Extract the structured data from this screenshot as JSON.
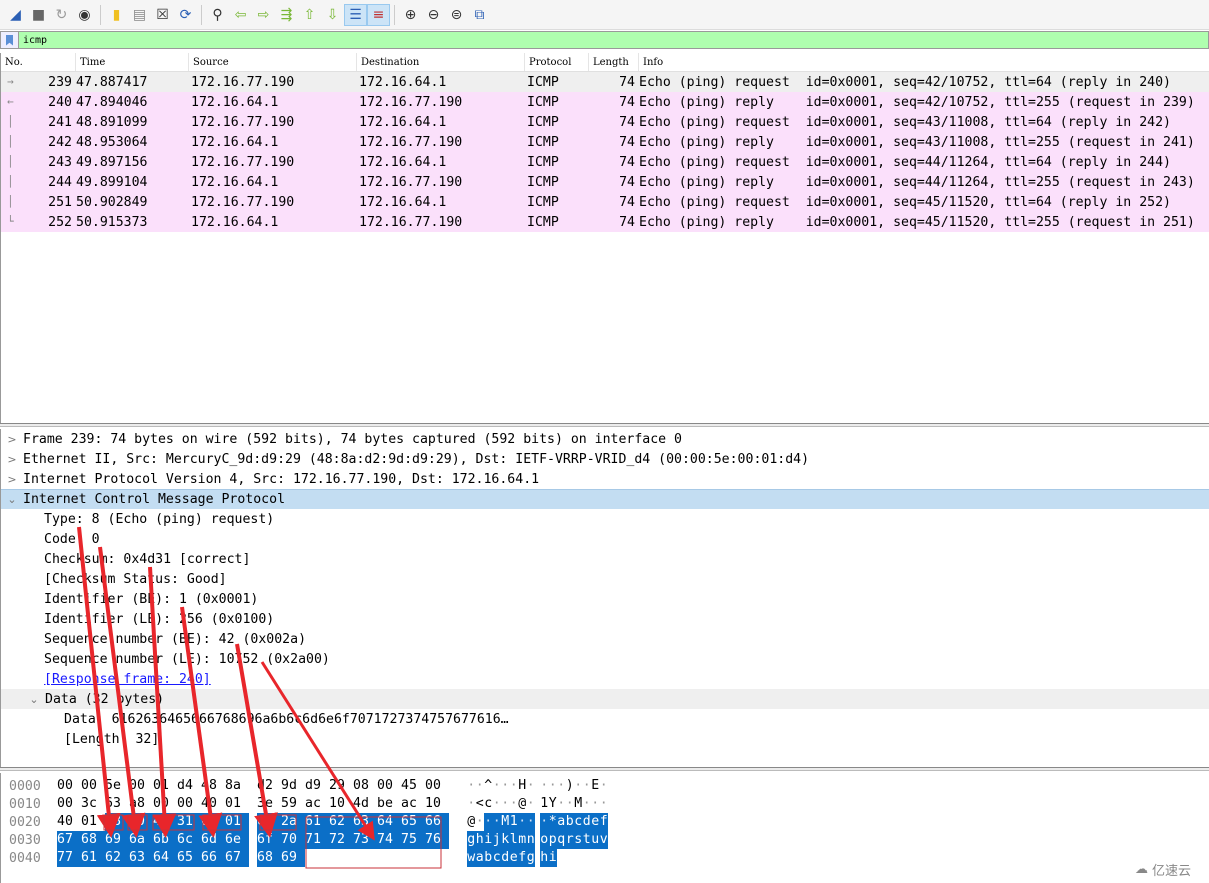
{
  "toolbar": {
    "buttons": [
      {
        "name": "start-capture-icon",
        "glyph": "◢"
      },
      {
        "name": "stop-capture-icon",
        "glyph": "■"
      },
      {
        "name": "restart-capture-icon",
        "glyph": "↻"
      },
      {
        "name": "capture-options-icon",
        "glyph": "◉"
      },
      {
        "name": "open-file-icon",
        "glyph": "▮"
      },
      {
        "name": "save-file-icon",
        "glyph": "▤"
      },
      {
        "name": "close-file-icon",
        "glyph": "☒"
      },
      {
        "name": "reload-file-icon",
        "glyph": "⟳"
      },
      {
        "name": "find-packet-icon",
        "glyph": "⚲"
      },
      {
        "name": "go-back-icon",
        "glyph": "⇦"
      },
      {
        "name": "go-forward-icon",
        "glyph": "⇨"
      },
      {
        "name": "go-to-packet-icon",
        "glyph": "⇶"
      },
      {
        "name": "go-first-packet-icon",
        "glyph": "⇧"
      },
      {
        "name": "go-last-packet-icon",
        "glyph": "⇩"
      },
      {
        "name": "auto-scroll-icon",
        "glyph": "☰"
      },
      {
        "name": "colorize-icon",
        "glyph": "≡"
      },
      {
        "name": "zoom-in-icon",
        "glyph": "⊕"
      },
      {
        "name": "zoom-out-icon",
        "glyph": "⊖"
      },
      {
        "name": "normal-size-icon",
        "glyph": "⊜"
      },
      {
        "name": "resize-columns-icon",
        "glyph": "⧉"
      }
    ]
  },
  "filter": {
    "value": "icmp"
  },
  "packet_list": {
    "columns": [
      "No.",
      "Time",
      "Source",
      "Destination",
      "Protocol",
      "Length",
      "Info"
    ],
    "rows": [
      {
        "no": "239",
        "time": "47.887417",
        "src": "172.16.77.190",
        "dst": "172.16.64.1",
        "proto": "ICMP",
        "len": "74",
        "info": "Echo (ping) request  id=0x0001, seq=42/10752, ttl=64 (reply in 240)",
        "rel": "→"
      },
      {
        "no": "240",
        "time": "47.894046",
        "src": "172.16.64.1",
        "dst": "172.16.77.190",
        "proto": "ICMP",
        "len": "74",
        "info": "Echo (ping) reply    id=0x0001, seq=42/10752, ttl=255 (request in 239)",
        "rel": "←"
      },
      {
        "no": "241",
        "time": "48.891099",
        "src": "172.16.77.190",
        "dst": "172.16.64.1",
        "proto": "ICMP",
        "len": "74",
        "info": "Echo (ping) request  id=0x0001, seq=43/11008, ttl=64 (reply in 242)",
        "rel": "│"
      },
      {
        "no": "242",
        "time": "48.953064",
        "src": "172.16.64.1",
        "dst": "172.16.77.190",
        "proto": "ICMP",
        "len": "74",
        "info": "Echo (ping) reply    id=0x0001, seq=43/11008, ttl=255 (request in 241)",
        "rel": "│"
      },
      {
        "no": "243",
        "time": "49.897156",
        "src": "172.16.77.190",
        "dst": "172.16.64.1",
        "proto": "ICMP",
        "len": "74",
        "info": "Echo (ping) request  id=0x0001, seq=44/11264, ttl=64 (reply in 244)",
        "rel": "│"
      },
      {
        "no": "244",
        "time": "49.899104",
        "src": "172.16.64.1",
        "dst": "172.16.77.190",
        "proto": "ICMP",
        "len": "74",
        "info": "Echo (ping) reply    id=0x0001, seq=44/11264, ttl=255 (request in 243)",
        "rel": "│"
      },
      {
        "no": "251",
        "time": "50.902849",
        "src": "172.16.77.190",
        "dst": "172.16.64.1",
        "proto": "ICMP",
        "len": "74",
        "info": "Echo (ping) request  id=0x0001, seq=45/11520, ttl=64 (reply in 252)",
        "rel": "│"
      },
      {
        "no": "252",
        "time": "50.915373",
        "src": "172.16.64.1",
        "dst": "172.16.77.190",
        "proto": "ICMP",
        "len": "74",
        "info": "Echo (ping) reply    id=0x0001, seq=45/11520, ttl=255 (request in 251)",
        "rel": "└"
      }
    ]
  },
  "details": {
    "frame": "Frame 239: 74 bytes on wire (592 bits), 74 bytes captured (592 bits) on interface 0",
    "ethernet": "Ethernet II, Src: MercuryC_9d:d9:29 (48:8a:d2:9d:d9:29), Dst: IETF-VRRP-VRID_d4 (00:00:5e:00:01:d4)",
    "ip": "Internet Protocol Version 4, Src: 172.16.77.190, Dst: 172.16.64.1",
    "icmp": "Internet Control Message Protocol",
    "fields": [
      "Type: 8 (Echo (ping) request)",
      "Code: 0",
      "Checksum: 0x4d31 [correct]",
      "[Checksum Status: Good]",
      "Identifier (BE): 1 (0x0001)",
      "Identifier (LE): 256 (0x0100)",
      "Sequence number (BE): 42 (0x002a)",
      "Sequence number (LE): 10752 (0x2a00)"
    ],
    "response_link": "[Response frame: 240]",
    "data_node": "Data (32 bytes)",
    "data_value": "Data: 6162636465666768696a6b6c6d6e6f7071727374757677616…",
    "data_length": "[Length: 32]",
    "collapsed_glyph": ">",
    "expanded_glyph": "⌄"
  },
  "bytes": {
    "rows": [
      {
        "offset": "0000",
        "hex": [
          "00",
          "00",
          "5e",
          "00",
          "01",
          "d4",
          "48",
          "8a",
          "d2",
          "9d",
          "d9",
          "29",
          "08",
          "00",
          "45",
          "00"
        ],
        "ascii": "··^···H·)··E·",
        "sel_from": 99
      },
      {
        "offset": "0010",
        "hex": [
          "00",
          "3c",
          "63",
          "a8",
          "00",
          "00",
          "40",
          "01",
          "3e",
          "59",
          "ac",
          "10",
          "4d",
          "be",
          "ac",
          "10"
        ],
        "ascii": "·<c···@·>Y··M···",
        "sel_from": 99
      },
      {
        "offset": "0020",
        "hex": [
          "40",
          "01",
          "08",
          "00",
          "4d",
          "31",
          "00",
          "01",
          "00",
          "2a",
          "61",
          "62",
          "63",
          "64",
          "65",
          "66"
        ],
        "ascii": "@···M1···*abcdef",
        "sel_from": 2
      },
      {
        "offset": "0030",
        "hex": [
          "67",
          "68",
          "69",
          "6a",
          "6b",
          "6c",
          "6d",
          "6e",
          "6f",
          "70",
          "71",
          "72",
          "73",
          "74",
          "75",
          "76"
        ],
        "ascii": "ghijklmnopqrstuv",
        "sel_from": 0
      },
      {
        "offset": "0040",
        "hex": [
          "77",
          "61",
          "62",
          "63",
          "64",
          "65",
          "66",
          "67",
          "68",
          "69"
        ],
        "ascii": "wabcdefghi",
        "sel_from": 0
      }
    ],
    "ascii_display": [
      "··^···H· ···)··E·",
      "·<c···@· 1Y··M···",
      "@···M1·· ·*abcdef",
      "ghijklmn opqrstuv",
      "wabcdefg hi"
    ]
  },
  "watermark": {
    "text": "亿速云"
  },
  "colors": {
    "filter_bg": "#afffaf",
    "row_bg": "#fbe0fb",
    "selected_row_bg": "#efefef",
    "tree_selected_bg": "#c3ddf2",
    "byte_highlight": "#0b6fc7",
    "annotation_red": "#e8262b"
  }
}
